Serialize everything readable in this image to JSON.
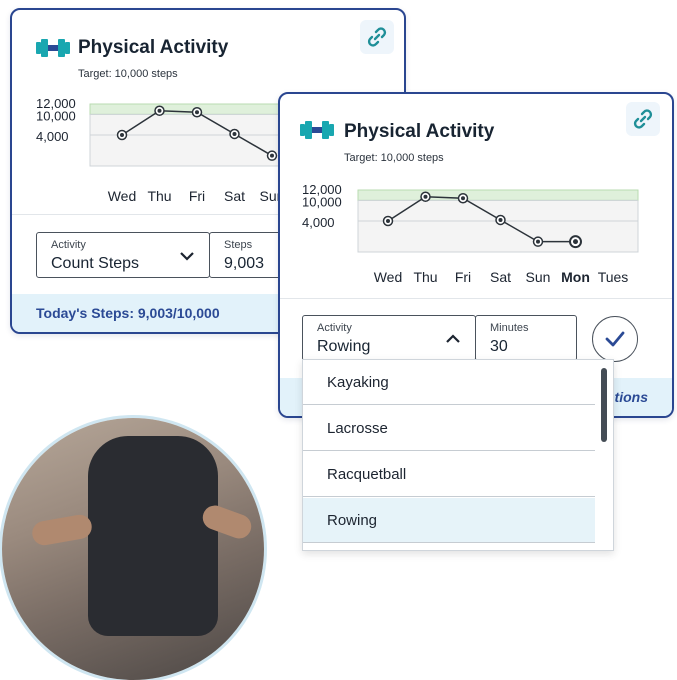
{
  "colors": {
    "accent": "#2b4a95",
    "teal": "#19a7b0",
    "target_band": "#dff0db"
  },
  "card_back": {
    "title": "Physical Activity",
    "subtitle": "Target: 10,000 steps",
    "icon": "dumbbell-icon",
    "link_icon": "link-icon",
    "activity_label": "Activity",
    "activity_value": "Count Steps",
    "steps_label": "Steps",
    "steps_value": "9,003",
    "footer": "Today's Steps: 9,003/10,000"
  },
  "card_front": {
    "title": "Physical Activity",
    "subtitle": "Target: 10,000 steps",
    "icon": "dumbbell-icon",
    "link_icon": "link-icon",
    "activity_label": "Activity",
    "activity_value": "Rowing",
    "minutes_label": "Minutes",
    "minutes_value": "30",
    "check_icon": "check-icon",
    "footer_partial": "ptions"
  },
  "dropdown": {
    "options": [
      "Kayaking",
      "Lacrosse",
      "Racquetball",
      "Rowing"
    ],
    "selected": "Rowing"
  },
  "chart_data": [
    {
      "type": "line",
      "x": [
        "Wed",
        "Thu",
        "Fri",
        "Sat",
        "Sun"
      ],
      "values": [
        6000,
        10700,
        10400,
        6200,
        2000
      ],
      "y_tick_labels": [
        "12,000",
        "10,000",
        "4,000"
      ],
      "target_band": [
        10000,
        12000
      ]
    },
    {
      "type": "line",
      "x": [
        "Wed",
        "Thu",
        "Fri",
        "Sat",
        "Sun",
        "Mon",
        "Tues"
      ],
      "values": [
        6000,
        10700,
        10400,
        6200,
        2000,
        2000,
        null
      ],
      "highlight": "Mon",
      "y_tick_labels": [
        "12,000",
        "10,000",
        "4,000"
      ],
      "target_band": [
        10000,
        12000
      ]
    }
  ]
}
